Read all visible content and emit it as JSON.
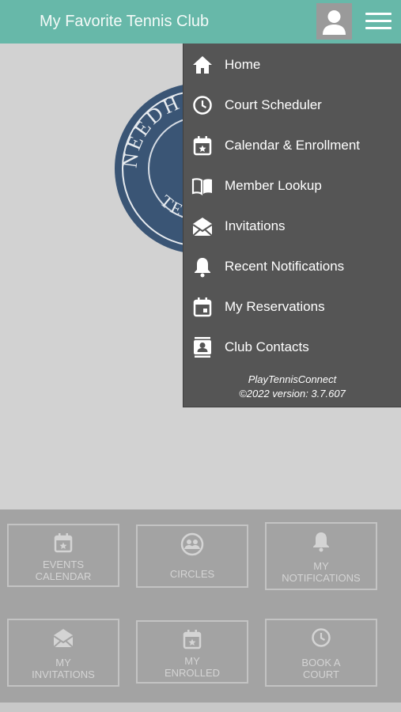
{
  "header": {
    "title": "My Favorite Tennis Club",
    "profile_icon": "person-icon",
    "menu_icon": "hamburger-icon",
    "color": "#67b8a9"
  },
  "logo": {
    "text_top": "NEEDHAM",
    "text_bottom": "TENNIS"
  },
  "menu": {
    "items": [
      {
        "label": "Home",
        "icon": "home-icon"
      },
      {
        "label": "Court Scheduler",
        "icon": "clock-icon"
      },
      {
        "label": "Calendar & Enrollment",
        "icon": "calendar-star-icon"
      },
      {
        "label": "Member Lookup",
        "icon": "book-icon"
      },
      {
        "label": "Invitations",
        "icon": "envelope-icon"
      },
      {
        "label": "Recent Notifications",
        "icon": "bell-icon"
      },
      {
        "label": "My Reservations",
        "icon": "calendar-icon"
      },
      {
        "label": "Club Contacts",
        "icon": "contacts-icon"
      }
    ],
    "footer_brand": "PlayTennisConnect",
    "footer_version": "©2022 version: 3.7.607"
  },
  "tiles": [
    {
      "line1": "EVENTS",
      "line2": "CALENDAR",
      "icon": "calendar-star-icon"
    },
    {
      "line1": "CIRCLES",
      "line2": "",
      "icon": "circles-icon"
    },
    {
      "line1": "MY",
      "line2": "NOTIFICATIONS",
      "icon": "bell-icon"
    },
    {
      "line1": "MY",
      "line2": "INVITATIONS",
      "icon": "envelope-icon"
    },
    {
      "line1": "MY",
      "line2": "ENROLLED",
      "icon": "calendar-star-icon"
    },
    {
      "line1": "BOOK A",
      "line2": "COURT",
      "icon": "clock-icon"
    }
  ]
}
